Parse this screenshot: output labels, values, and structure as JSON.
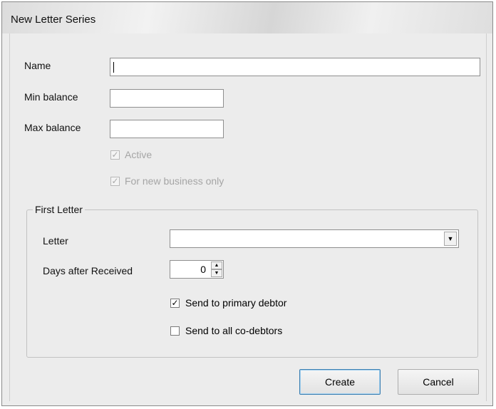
{
  "window": {
    "title": "New Letter Series"
  },
  "form": {
    "name_label": "Name",
    "name_value": "",
    "min_balance_label": "Min balance",
    "min_balance_value": "",
    "max_balance_label": "Max balance",
    "max_balance_value": "",
    "active": {
      "label": "Active",
      "checked": true,
      "enabled": false
    },
    "new_business": {
      "label": "For new business only",
      "checked": true,
      "enabled": false
    }
  },
  "first_letter": {
    "group_title": "First Letter",
    "letter_label": "Letter",
    "letter_value": "",
    "days_label": "Days after Received",
    "days_value": "0",
    "send_primary": {
      "label": "Send to primary debtor",
      "checked": true
    },
    "send_all": {
      "label": "Send to all co-debtors",
      "checked": false
    }
  },
  "buttons": {
    "create": "Create",
    "cancel": "Cancel"
  },
  "icons": {
    "check": "✓",
    "dropdown": "▼",
    "spin_up": "▲",
    "spin_down": "▼"
  }
}
